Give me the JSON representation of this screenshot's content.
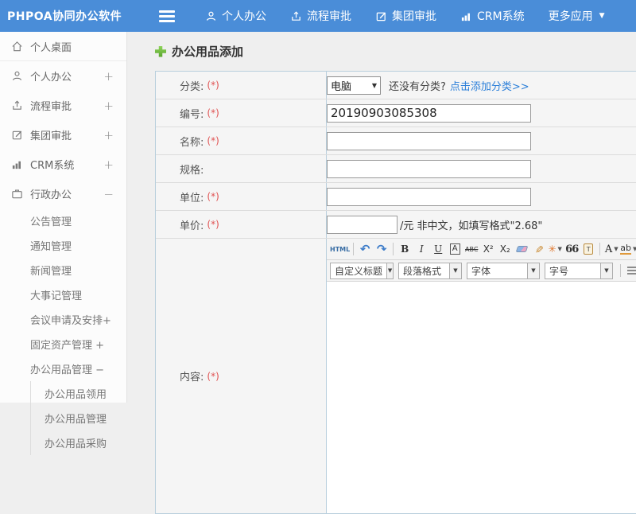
{
  "navbar": {
    "brand": "PHPOA协同办公软件",
    "items": [
      {
        "label": "个人办公"
      },
      {
        "label": "流程审批"
      },
      {
        "label": "集团审批"
      },
      {
        "label": "CRM系统"
      },
      {
        "label": "更多应用"
      }
    ]
  },
  "sidebar": {
    "items": [
      {
        "label": "个人桌面",
        "expand": ""
      },
      {
        "label": "个人办公",
        "expand": "+"
      },
      {
        "label": "流程审批",
        "expand": "+"
      },
      {
        "label": "集团审批",
        "expand": "+"
      },
      {
        "label": "CRM系统",
        "expand": "+"
      },
      {
        "label": "行政办公",
        "expand": "−"
      }
    ],
    "admin_submenu": [
      {
        "label": "公告管理"
      },
      {
        "label": "通知管理"
      },
      {
        "label": "新闻管理"
      },
      {
        "label": "大事记管理"
      },
      {
        "label": "会议申请及安排+"
      },
      {
        "label": "固定资产管理 +"
      },
      {
        "label": "办公用品管理 −"
      }
    ],
    "supplies_submenu": [
      {
        "label": "办公用品领用"
      },
      {
        "label": "办公用品管理"
      },
      {
        "label": "办公用品采购"
      }
    ]
  },
  "main": {
    "title": "办公用品添加",
    "form": {
      "category": {
        "label": "分类:",
        "required": "(*)",
        "selected": "电脑",
        "hint": "还没有分类?",
        "link": "点击添加分类>>"
      },
      "code": {
        "label": "编号:",
        "required": "(*)",
        "value": "20190903085308"
      },
      "name": {
        "label": "名称:",
        "required": "(*)",
        "value": ""
      },
      "spec": {
        "label": "规格:",
        "required": "",
        "value": ""
      },
      "unit": {
        "label": "单位:",
        "required": "(*)",
        "value": ""
      },
      "price": {
        "label": "单价:",
        "required": "(*)",
        "value": "",
        "suffix": "/元 非中文，如填写格式\"2.68\""
      },
      "content": {
        "label": "内容:",
        "required": "(*)"
      }
    },
    "editor": {
      "row1": {
        "html": "HTML",
        "undo": "↶",
        "redo": "↷",
        "bold": "B",
        "italic": "I",
        "underline": "U",
        "fontbox": "A",
        "strike": "ABC",
        "superscript": "X²",
        "subscript": "X₂",
        "broom": "✎",
        "wand": "✳",
        "quote": "66",
        "paste": "T",
        "fontcolor": "A",
        "highlight": "ab"
      },
      "row2": {
        "custom_title": "自定义标题",
        "paragraph": "段落格式",
        "font": "字体",
        "size": "字号"
      }
    }
  },
  "icons": {
    "caret": "▼",
    "dd_caret": "▼",
    "link_glyph": "∞"
  },
  "colors": {
    "navbar": "#4a8dd8",
    "link": "#2b7fd9",
    "required": "#e05252",
    "title_plus": "#6bbd3f",
    "table_border": "#b9cfdd"
  }
}
